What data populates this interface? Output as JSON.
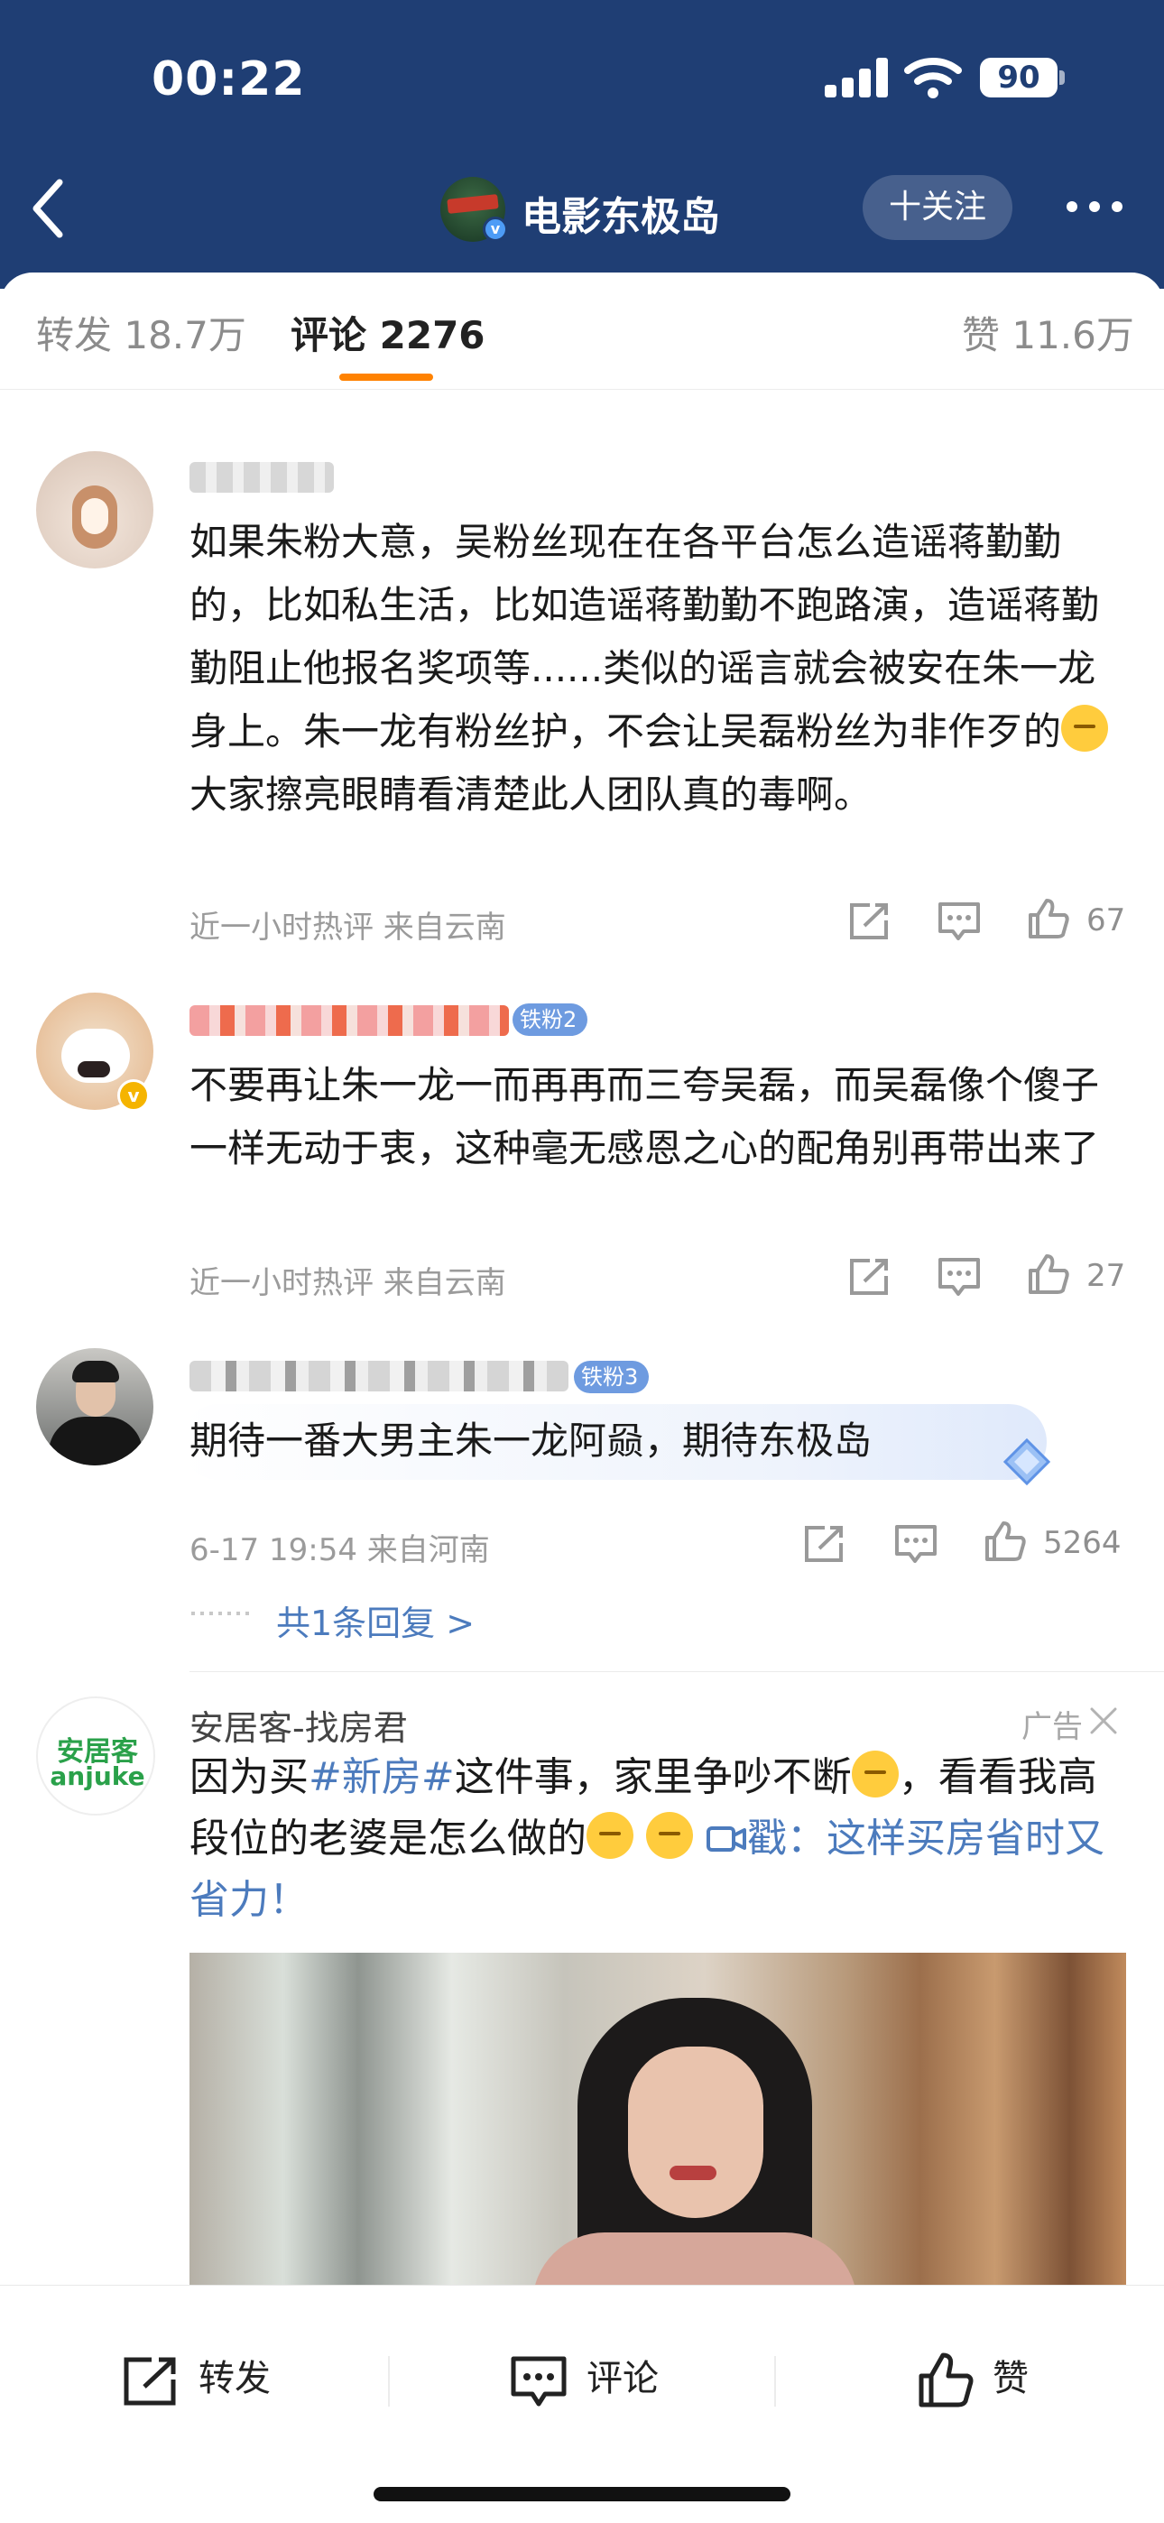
{
  "status_bar": {
    "time": "00:22",
    "battery": "90"
  },
  "header": {
    "title": "电影东极岛",
    "follow_label": "十关注"
  },
  "tabs": [
    {
      "label": "转发 18.7万"
    },
    {
      "label": "评论 2276"
    },
    {
      "label": "赞 11.6万"
    }
  ],
  "comments": [
    {
      "text_before_emoji": "如果朱粉大意，吴粉丝现在在各平台怎么造谣蒋勤勤的，比如私生活，比如造谣蒋勤勤不跑路演，造谣蒋勤勤阻止他报名奖项等......类似的谣言就会被安在朱一龙身上。朱一龙有粉丝护，不会让吴磊粉丝为非作歹的",
      "text_after_emoji": " 大家擦亮眼睛看清楚此人团队真的毒啊。",
      "meta": "近一小时热评  来自云南",
      "likes": "67"
    },
    {
      "badge": "铁粉2",
      "text": "不要再让朱一龙一而再再而三夸吴磊，而吴磊像个傻子一样无动于衷，这种毫无感恩之心的配角别再带出来了",
      "meta": "近一小时热评  来自云南",
      "likes": "27"
    },
    {
      "badge": "铁粉3",
      "text": "期待一番大男主朱一龙阿赑，期待东极岛",
      "meta": "6-17 19:54  来自河南",
      "likes": "5264",
      "replies": "共1条回复 >"
    }
  ],
  "ad": {
    "logo_line1": "安居客",
    "logo_line2": "anjuke",
    "name": "安居客-找房君",
    "tag": "广告",
    "text_1": "因为买",
    "hashtag": "#新房#",
    "text_2": "这件事，家里争吵不断",
    "text_3": "，看看我高段位的老婆是怎么做的",
    "link": "戳：这样买房省时又省力！"
  },
  "bottom_bar": {
    "repost": "转发",
    "comment": "评论",
    "like": "赞"
  },
  "colors": {
    "header_bg": "#1f3e74",
    "accent": "#ff8200",
    "link": "#4c7bbd",
    "badge": "#6e9be0"
  },
  "icons": [
    "back-icon",
    "more-icon",
    "repost-icon",
    "comment-icon",
    "like-icon",
    "close-icon",
    "video-icon",
    "verified-icon"
  ]
}
